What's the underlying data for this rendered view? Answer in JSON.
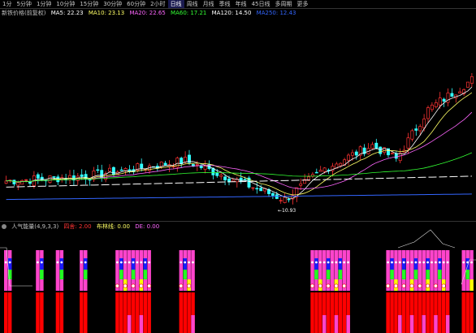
{
  "tabs": [
    "1分",
    "5分钟",
    "1分钟",
    "10分钟",
    "15分钟",
    "30分钟",
    "60分钟",
    "2小时",
    "日线",
    "周线",
    "月线",
    "季线",
    "年线",
    "45日线",
    "多周期",
    "更多"
  ],
  "active_tab": "日线",
  "main_legend": {
    "title": "新铁价格(前复权)",
    "ma5": "MA5: 22.23",
    "ma10": "MA10: 23.13",
    "ma20": "MA20: 22.65",
    "ma60": "MA60: 17.21",
    "ma120": "MA120: 14.50",
    "ma250": "MA250: 12.43",
    "colors": {
      "title": "#c0c0c0",
      "ma5": "#ffffff",
      "ma10": "#ffff66",
      "ma20": "#ff66ff",
      "ma60": "#33ff33",
      "ma120": "#ffffff",
      "ma250": "#3366ff"
    }
  },
  "low_marker": "←10.93",
  "sub_legend": {
    "title": "人气能量(4,9,3,3)",
    "v1": "四舍: 2.00",
    "v2": "布林线: 0.00",
    "v3": "DE: 0.00",
    "colors": {
      "title": "#c0c0c0",
      "v1": "#ff3333",
      "v2": "#ffff66",
      "v3": "#ff66ff"
    }
  },
  "colors": {
    "up": "#ff3333",
    "down": "#33ffff",
    "bg": "#000000",
    "magenta": "#ff44cc",
    "blue": "#1a1aff",
    "green": "#22ff22",
    "yellow": "#ffff00",
    "red": "#ff0000"
  }
}
